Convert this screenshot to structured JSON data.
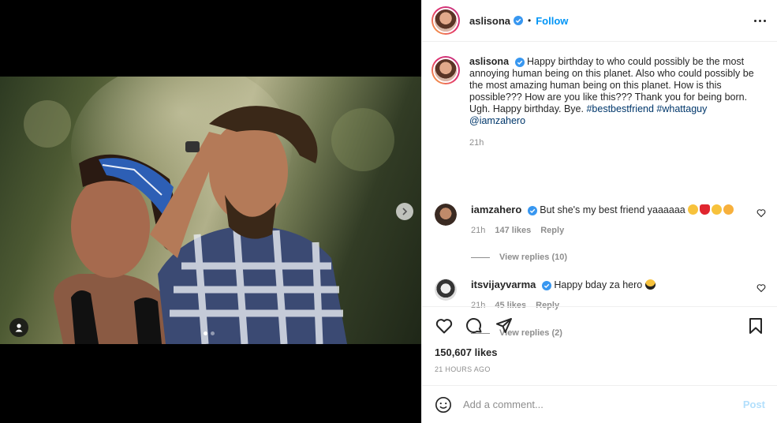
{
  "post": {
    "username": "aslisona",
    "follow_label": "Follow",
    "separator": "•",
    "caption_text": "Happy birthday to who could possibly be the most annoying human being on this planet. Also who could possibly be the most amazing human being on this planet. How is this possible??? How are you like this??? Thank you for being born. Ugh. Happy birthday. Bye.",
    "caption_tags": "#bestbestfriend #whattaguy @iamzahero",
    "caption_time": "21h",
    "likes": "150,607 likes",
    "posted_ago": "21 HOURS AGO"
  },
  "comments": [
    {
      "username": "iamzahero",
      "text": "But she's my best friend yaaaaaa",
      "time": "21h",
      "likes": "147 likes",
      "reply_label": "Reply",
      "view_replies": "View replies (10)"
    },
    {
      "username": "itsvijayvarma",
      "text": "Happy bday za hero",
      "time": "21h",
      "likes": "45 likes",
      "reply_label": "Reply",
      "view_replies": "View replies (2)"
    }
  ],
  "add_comment": {
    "placeholder": "Add a comment...",
    "post_label": "Post"
  },
  "colors": {
    "accent": "#0095f6",
    "verified": "#3897f0",
    "tag_link": "#00376b",
    "muted": "#8e8e8e"
  },
  "icons": [
    "verified-badge-icon",
    "more-options-icon",
    "heart-icon",
    "comment-icon",
    "share-icon",
    "bookmark-icon",
    "emoji-icon",
    "chevron-right-icon",
    "user-tag-icon"
  ]
}
